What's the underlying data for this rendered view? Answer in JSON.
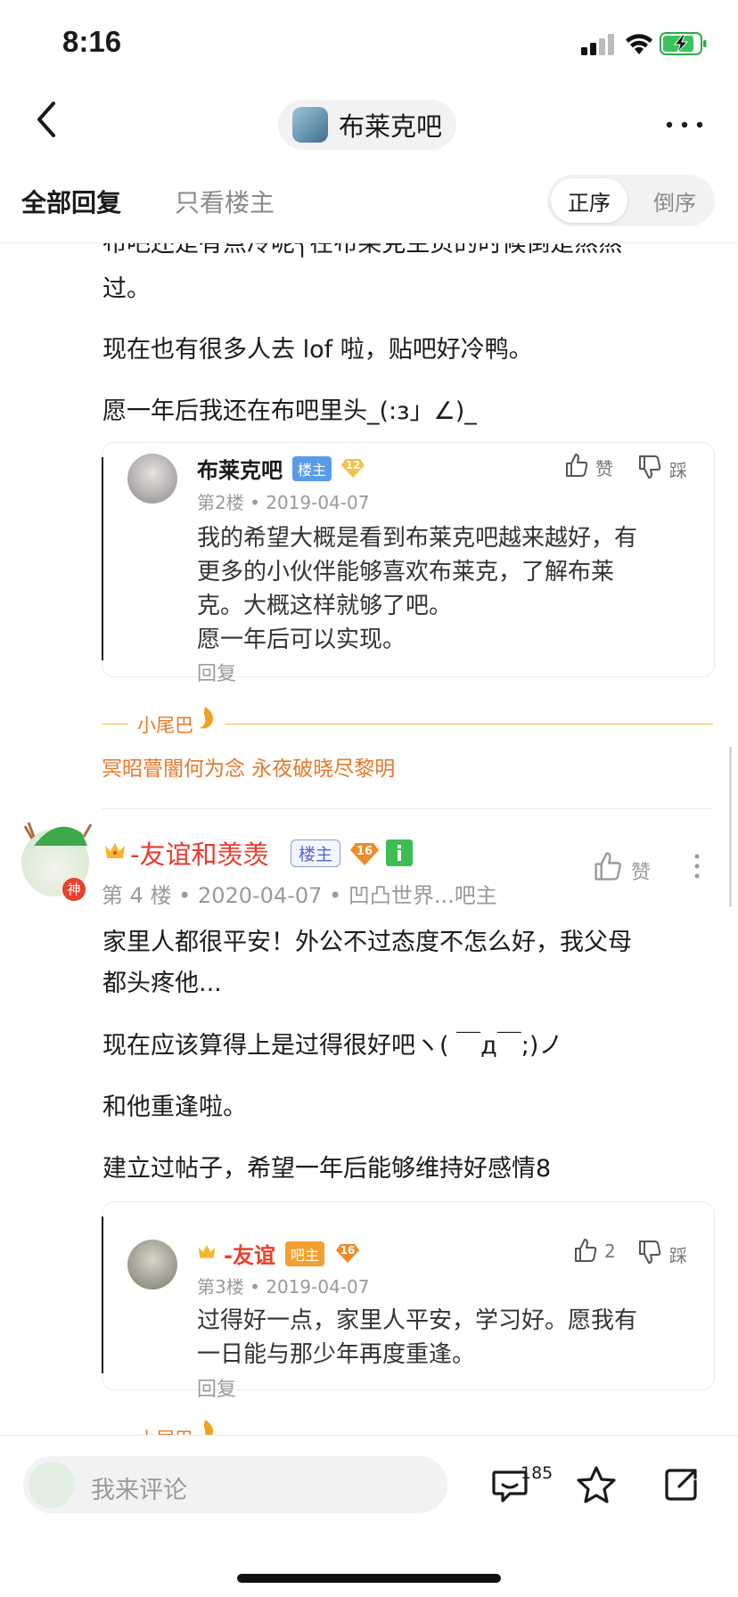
{
  "status_bar": {
    "time": "8:16"
  },
  "nav": {
    "forum_name": "布莱克吧"
  },
  "tabs": {
    "all_replies": "全部回复",
    "owner_only": "只看楼主",
    "sort_asc": "正序",
    "sort_desc": "倒序"
  },
  "post_top": {
    "cut_line": "布吧还是有点冷呢╮在布莱克主页的时候倒是熬熬",
    "lines": [
      "过。",
      "现在也有很多人去 lof 啦，贴吧好冷鸭。",
      "愿一年后我还在布吧里头_(:з」∠)_"
    ]
  },
  "quote1": {
    "author": "布莱克吧",
    "badge": "楼主",
    "level": "12",
    "meta": "第2楼 • 2019-04-07",
    "lines": [
      "我的希望大概是看到布莱克吧越来越好，有",
      "更多的小伙伴能够喜欢布莱克，了解布莱",
      "克。大概这样就够了吧。",
      "愿一年后可以实现。"
    ],
    "reply": "回复",
    "like": "赞",
    "dislike": "踩"
  },
  "tail": {
    "label": "小尾巴",
    "signature": "冥昭瞢闇何为念 永夜破晓尽黎明"
  },
  "floor4": {
    "avatar_badge": "神",
    "author": "-友谊和羡羡",
    "badge": "楼主",
    "level": "16",
    "meta": "第 4 楼  • 2020-04-07  • 凹凸世界...吧主",
    "like": "赞",
    "lines": [
      "家里人都很平安！外公不过态度不怎么好，我父母",
      "都头疼他...",
      "现在应该算得上是过得很好吧ヽ( ￣д￣;)ノ",
      "和他重逢啦。",
      "建立过帖子，希望一年后能够维持好感情8"
    ]
  },
  "quote2": {
    "author": "-友谊",
    "badge": "吧主",
    "level": "16",
    "meta": "第3楼 • 2019-04-07",
    "lines": [
      "过得好一点，家里人平安，学习好。愿我有",
      "一日能与那少年再度重逢。"
    ],
    "reply": "回复",
    "like_count": "2",
    "dislike": "踩"
  },
  "tail2": {
    "label": "小尾巴"
  },
  "bottom_bar": {
    "placeholder": "我来评论",
    "comment_count": "185"
  }
}
